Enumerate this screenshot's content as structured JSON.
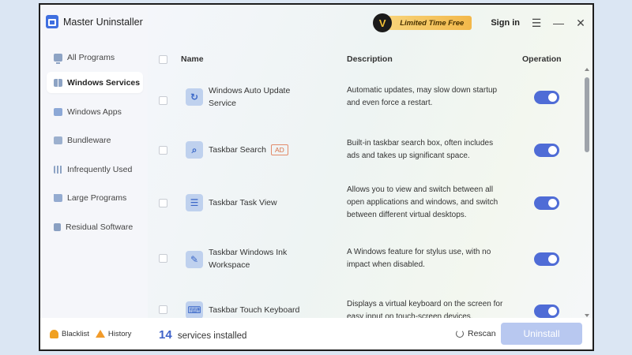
{
  "app": {
    "title": "Master Uninstaller"
  },
  "topbar": {
    "promo_badge": "V",
    "promo_label": "Limited Time Free",
    "signin": "Sign in",
    "menu_icon": "☰",
    "minimize_icon": "—",
    "close_icon": "✕"
  },
  "sidebar": {
    "items": [
      {
        "label": "All Programs",
        "icon": "monitor-icon"
      },
      {
        "label": "Windows Services",
        "icon": "windows-icon"
      },
      {
        "label": "Windows Apps",
        "icon": "apps-icon"
      },
      {
        "label": "Bundleware",
        "icon": "box-icon"
      },
      {
        "label": "Infrequently Used",
        "icon": "bars-icon"
      },
      {
        "label": "Large Programs",
        "icon": "folder-icon"
      },
      {
        "label": "Residual Software",
        "icon": "trash-icon"
      }
    ],
    "footer": {
      "blacklist": "Blacklist",
      "history": "History"
    }
  },
  "table": {
    "headers": {
      "name": "Name",
      "description": "Description",
      "operation": "Operation"
    },
    "rows": [
      {
        "name": "Windows Auto Update Service",
        "ad": "",
        "desc": "Automatic updates, may slow down startup and even force a restart.",
        "icon": "↻"
      },
      {
        "name": "Taskbar Search",
        "ad": "AD",
        "desc": "Built-in taskbar search box, often includes ads and takes up significant space.",
        "icon": "⌕"
      },
      {
        "name": "Taskbar Task View",
        "ad": "",
        "desc": "Allows you to view and switch between all open applications and windows, and switch between different virtual desktops.",
        "icon": "☰"
      },
      {
        "name": "Taskbar Windows Ink Workspace",
        "ad": "",
        "desc": "A Windows feature for stylus use, with no impact when disabled.",
        "icon": "✎"
      },
      {
        "name": "Taskbar Touch Keyboard",
        "ad": "",
        "desc": "Displays a virtual keyboard on the screen for easy input on touch-screen devices.",
        "icon": "⌨"
      }
    ]
  },
  "bottom": {
    "count": "14",
    "count_label": "services installed",
    "rescan": "Rescan",
    "uninstall": "Uninstall"
  }
}
